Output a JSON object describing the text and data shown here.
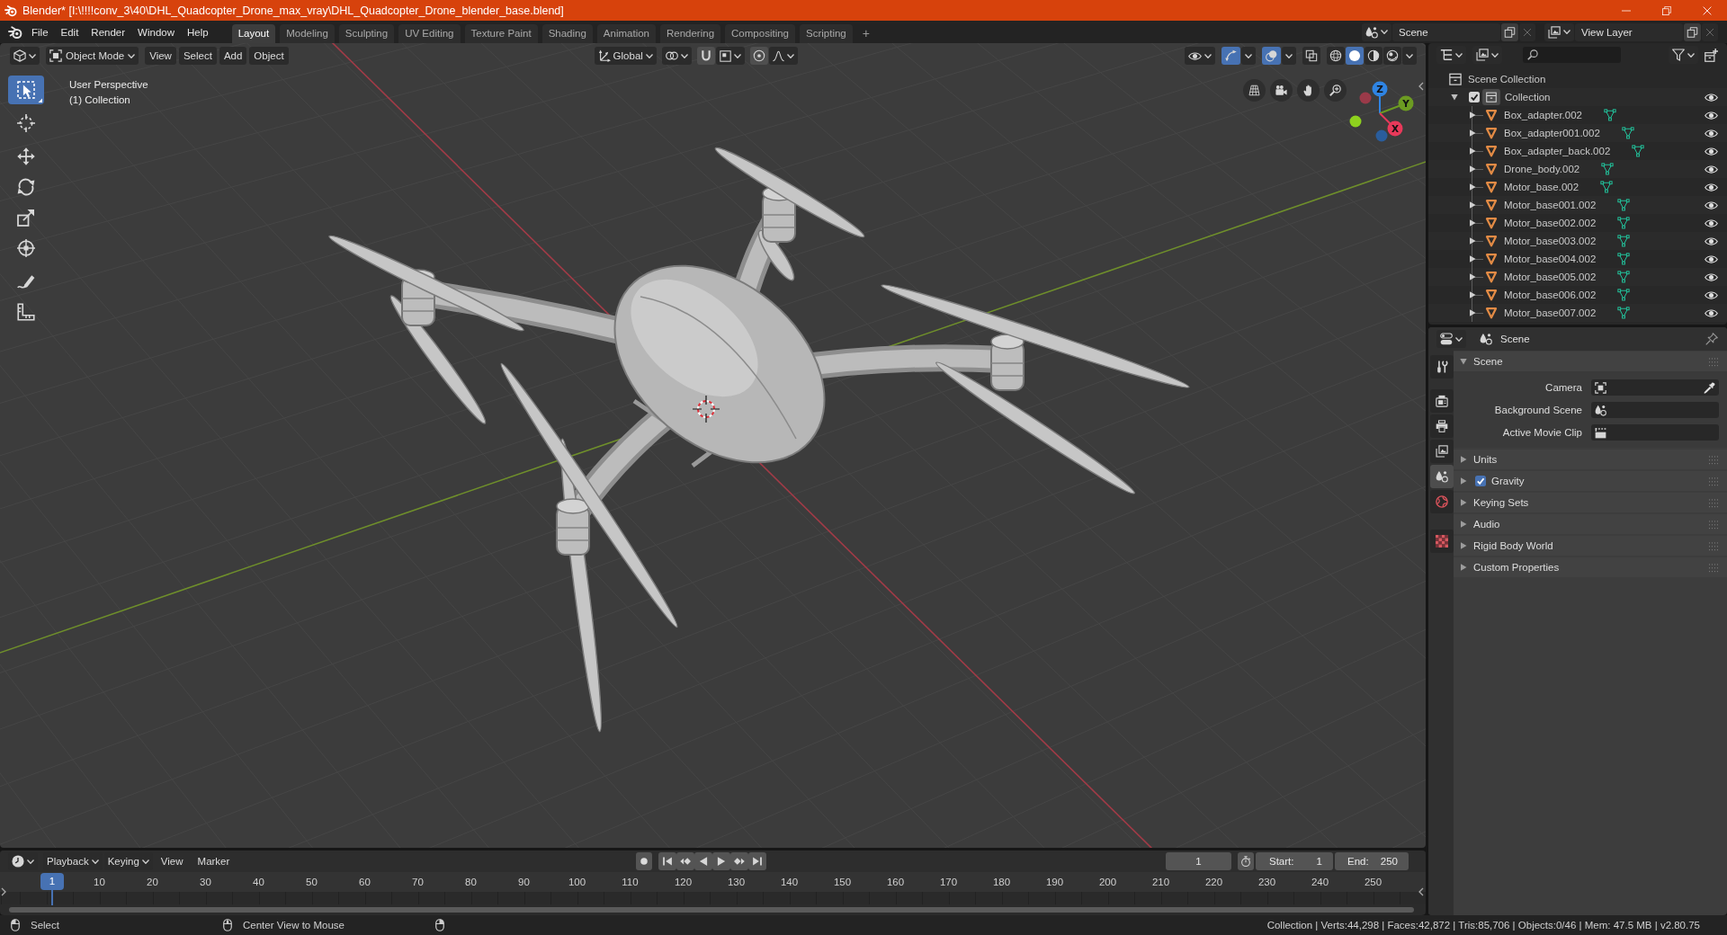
{
  "window": {
    "title": "Blender* [I:\\!!!!conv_3\\40\\DHL_Quadcopter_Drone_max_vray\\DHL_Quadcopter_Drone_blender_base.blend]"
  },
  "top_bar": {
    "menus": [
      "File",
      "Edit",
      "Render",
      "Window",
      "Help"
    ],
    "workspace_tabs": [
      {
        "label": "Layout",
        "selected": true
      },
      {
        "label": "Modeling",
        "selected": false
      },
      {
        "label": "Sculpting",
        "selected": false
      },
      {
        "label": "UV Editing",
        "selected": false
      },
      {
        "label": "Texture Paint",
        "selected": false
      },
      {
        "label": "Shading",
        "selected": false
      },
      {
        "label": "Animation",
        "selected": false
      },
      {
        "label": "Rendering",
        "selected": false
      },
      {
        "label": "Compositing",
        "selected": false
      },
      {
        "label": "Scripting",
        "selected": false
      }
    ],
    "add_tab": "+",
    "scene": "Scene",
    "view_layer": "View Layer"
  },
  "viewport": {
    "header": {
      "mode": "Object Mode",
      "menus": [
        "View",
        "Select",
        "Add",
        "Object"
      ],
      "orientation": "Global",
      "gizmos": true,
      "overlays": true,
      "xray": false,
      "shading": [
        {
          "kind": "wireframe",
          "selected": false
        },
        {
          "kind": "solid",
          "selected": true
        },
        {
          "kind": "material",
          "selected": false
        },
        {
          "kind": "rendered",
          "selected": false
        }
      ]
    },
    "tools": [
      {
        "kind": "select_box",
        "selected": true
      },
      {
        "kind": "cursor",
        "selected": false
      },
      {
        "kind": "move",
        "selected": false
      },
      {
        "kind": "rotate",
        "selected": false
      },
      {
        "kind": "scale",
        "selected": false
      },
      {
        "kind": "transform",
        "selected": false
      },
      {
        "kind": "annotate",
        "selected": false
      },
      {
        "kind": "measure",
        "selected": false
      }
    ],
    "info": [
      "User Perspective",
      "(1) Collection"
    ],
    "axis_gizmo": {
      "axes": [
        {
          "label": "Z",
          "color": "#2f84e3"
        },
        {
          "label": "Y",
          "color": "#6c9b22"
        },
        {
          "label": "X",
          "color": "#e8395a"
        }
      ],
      "negative_axes": [
        {
          "color": "#9a3a49"
        },
        {
          "color": "#8ed11e"
        },
        {
          "color": "#2a5d9c"
        }
      ]
    }
  },
  "outliner": {
    "root": "Scene Collection",
    "collections": [
      {
        "label": "Collection",
        "checked": true,
        "expanded": true,
        "visible": true,
        "children": [
          {
            "label": "Box_adapter.002",
            "expanded": false,
            "visible": true
          },
          {
            "label": "Box_adapter001.002",
            "expanded": false,
            "visible": true
          },
          {
            "label": "Box_adapter_back.002",
            "expanded": false,
            "visible": true
          },
          {
            "label": "Drone_body.002",
            "expanded": false,
            "visible": true
          },
          {
            "label": "Motor_base.002",
            "expanded": false,
            "visible": true
          },
          {
            "label": "Motor_base001.002",
            "expanded": false,
            "visible": true
          },
          {
            "label": "Motor_base002.002",
            "expanded": false,
            "visible": true
          },
          {
            "label": "Motor_base003.002",
            "expanded": false,
            "visible": true
          },
          {
            "label": "Motor_base004.002",
            "expanded": false,
            "visible": true
          },
          {
            "label": "Motor_base005.002",
            "expanded": false,
            "visible": true
          },
          {
            "label": "Motor_base006.002",
            "expanded": false,
            "visible": true
          },
          {
            "label": "Motor_base007.002",
            "expanded": false,
            "visible": true
          }
        ]
      }
    ]
  },
  "properties": {
    "context": "Scene",
    "tabs": [
      {
        "kind": "tool",
        "selected": false
      },
      {
        "kind": "render",
        "selected": false
      },
      {
        "kind": "output",
        "selected": false
      },
      {
        "kind": "view_layer",
        "selected": false
      },
      {
        "kind": "scene",
        "selected": true
      },
      {
        "kind": "world",
        "selected": false
      },
      {
        "kind": "texture",
        "selected": false
      }
    ],
    "panels": [
      {
        "title": "Scene",
        "expanded": true,
        "fields": [
          {
            "label": "Camera",
            "kind": "camera"
          },
          {
            "label": "Background Scene",
            "kind": "scene"
          },
          {
            "label": "Active Movie Clip",
            "kind": "movie_clip"
          }
        ]
      },
      {
        "title": "Units",
        "expanded": false
      },
      {
        "title": "Gravity",
        "expanded": false,
        "toggle": {
          "checked": true
        }
      },
      {
        "title": "Keying Sets",
        "expanded": false
      },
      {
        "title": "Audio",
        "expanded": false
      },
      {
        "title": "Rigid Body World",
        "expanded": false
      },
      {
        "title": "Custom Properties",
        "expanded": false
      }
    ]
  },
  "timeline": {
    "menus": [
      {
        "label": "Playback",
        "kind": "dropdown"
      },
      {
        "label": "Keying",
        "kind": "dropdown"
      },
      {
        "label": "View",
        "kind": "menu"
      },
      {
        "label": "Marker",
        "kind": "menu"
      }
    ],
    "auto_keying": false,
    "current_frame": "1",
    "start_label": "Start:",
    "start": "1",
    "end_label": "End:",
    "end": "250",
    "playhead": "1",
    "ruler": [
      "10",
      "20",
      "30",
      "40",
      "50",
      "60",
      "70",
      "80",
      "90",
      "100",
      "110",
      "120",
      "130",
      "140",
      "150",
      "160",
      "170",
      "180",
      "190",
      "200",
      "210",
      "220",
      "230",
      "240",
      "250"
    ]
  },
  "status_bar": {
    "hints": [
      {
        "kind": "left_click",
        "label": "Select"
      },
      {
        "kind": "middle_click",
        "label": "Center View to Mouse"
      },
      {
        "kind": "right_click"
      }
    ],
    "stats": "Collection | Verts:44,298 | Faces:42,872 | Tris:85,706 | Objects:0/46 | Mem: 47.5 MB | v2.80.75"
  }
}
